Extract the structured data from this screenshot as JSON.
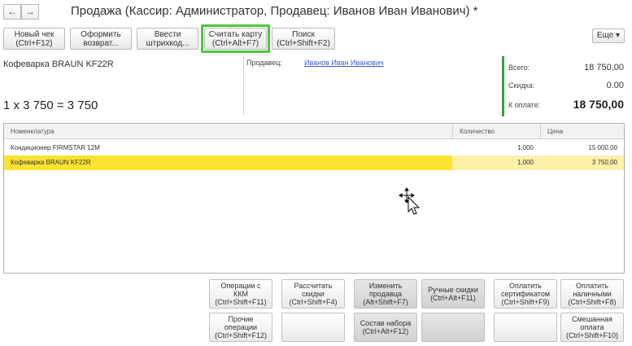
{
  "window": {
    "title": "Продажа (Кассир: Администратор, Продавец: Иванов Иван Иванович) *",
    "back_glyph": "←",
    "forward_glyph": "→"
  },
  "toolbar": {
    "buttons": [
      {
        "line1": "Новый чек",
        "line2": "(Ctrl+F12)"
      },
      {
        "line1": "Оформить",
        "line2": "возврат..."
      },
      {
        "line1": "Ввести",
        "line2": "штрихкод..."
      },
      {
        "line1": "Считать карту",
        "line2": "(Ctrl+Alt+F7)"
      },
      {
        "line1": "Поиск",
        "line2": "(Ctrl+Shift+F2)"
      }
    ],
    "more_label": "Еще",
    "more_arrow": "▾",
    "highlight_color": "#4cc93a"
  },
  "info": {
    "product_name": "Кофеварка BRAUN KF22R",
    "formula": "1 x 3 750 = 3 750",
    "seller_label": "Продавец:",
    "seller_value": "Иванов Иван Иванович"
  },
  "totals": {
    "total_label": "Всего:",
    "total_value": "18 750,00",
    "discount_label": "Скидка:",
    "discount_value": "0.00",
    "pay_label": "К оплате:",
    "pay_value": "18 750,00",
    "accent_color": "#3a9b4a"
  },
  "table": {
    "columns": [
      "Номенклатура",
      "Количество",
      "Цена"
    ],
    "rows": [
      {
        "name": "Кондиционер FIRMSTAR 12M",
        "qty": "1,000",
        "price": "15 000,00",
        "selected": false
      },
      {
        "name": "Кофеварка BRAUN KF22R",
        "qty": "1,000",
        "price": "3 750,00",
        "selected": true
      }
    ],
    "selected_color": "#fbe330"
  },
  "actions": {
    "row1": [
      {
        "lines": [
          "Операции с",
          "ККМ",
          "(Ctrl+Shift+F11)"
        ],
        "dark": false
      },
      {
        "lines": [
          "Рассчитать",
          "скидки",
          "(Ctrl+Shift+F4)"
        ],
        "dark": false
      },
      {
        "lines": [
          "Изменить",
          "продавца",
          "(Alt+Shift+F7)"
        ],
        "dark": true
      },
      {
        "lines": [
          "Ручные скидки",
          "(Ctrl+Alt+F11)"
        ],
        "dark": true
      },
      {
        "lines": [
          "Оплатить",
          "сертификатом",
          "(Ctrl+Shift+F9)"
        ],
        "dark": false
      },
      {
        "lines": [
          "Оплатить",
          "наличными",
          "(Ctrl+Shift+F8)"
        ],
        "dark": false
      }
    ],
    "row2": [
      {
        "lines": [
          "Прочие",
          "операции",
          "(Ctrl+Shift+F12)"
        ],
        "dark": false
      },
      {
        "lines": [],
        "dark": false
      },
      {
        "lines": [
          "Состав набора",
          "(Ctrl+Alt+F12)"
        ],
        "dark": true
      },
      {
        "lines": [],
        "dark": true
      },
      {
        "lines": [],
        "dark": false
      },
      {
        "lines": [
          "Смешанная",
          "оплата",
          "(Ctrl+Shift+F10)"
        ],
        "dark": false
      }
    ]
  }
}
